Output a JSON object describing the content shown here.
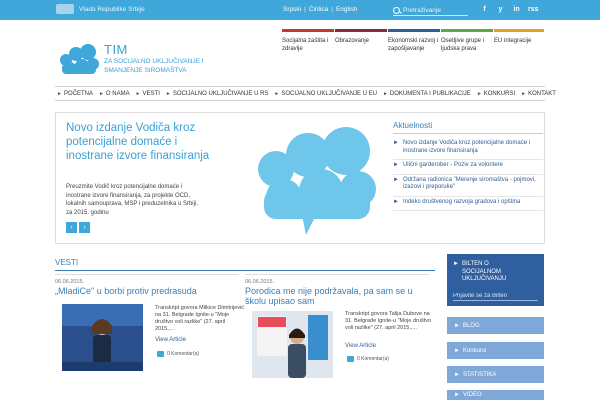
{
  "topbar": {
    "gov_label": "Vlada Republike Srbije",
    "langs": [
      "Srpski",
      "Ćirilica",
      "English"
    ],
    "search_placeholder": "Pretraživanje",
    "social": [
      "f",
      "y",
      "in",
      "rss"
    ]
  },
  "header": {
    "logo_title": "TIM",
    "logo_subtitle_1": "ZA SOCIJALNO UKLJUČIVANJE I",
    "logo_subtitle_2": "SMANJENJE SIROMAŠTVA",
    "themes": [
      {
        "label": "Socijalna zaštita i zdravlje",
        "color": "#c0392b"
      },
      {
        "label": "Obrazovanje",
        "color": "#8e2a35"
      },
      {
        "label": "Ekonomski razvoj i zapošljavanje",
        "color": "#2f5e94"
      },
      {
        "label": "Osetljive grupe i ljudska prava",
        "color": "#5aa84a"
      },
      {
        "label": "EU integracije",
        "color": "#e0a020"
      }
    ]
  },
  "nav": [
    "POČETNA",
    "O NAMA",
    "VESTI",
    "SOCIJALNO UKLJUČIVANJE U RS",
    "SOCIJALNO UKLJUČIVANJE U EU",
    "DOKUMENTA I PUBLIKACIJE",
    "KONKURSI",
    "KONTAKT"
  ],
  "hero": {
    "title": "Novo izdanje Vodiča kroz potencijalne domaće i inostrane izvore finansiranja",
    "desc": "Preuzmite Vodič kroz potencijalne domaće i inostrane izvore finansiranja, za projekte OCD, lokalnih samouprava, MSP i preduzetnika u Srbiji, za 2015. godinu",
    "prev": "‹",
    "next": "›"
  },
  "aktuelnosti": {
    "heading": "Aktuelnosti",
    "items": [
      "Novo izdanje Vodiča kroz potencijalne domaće i inostrane izvore finansiranja",
      "Ulični garderober - Poziv za volontere",
      "Održana radionica \"Merenje siromaštva - pojmovi, izazovi i preporuke\"",
      "Indeks društvenog razvoja gradova i opština"
    ]
  },
  "vesti": {
    "heading": "VESTI",
    "cards": [
      {
        "date": "06.06.2015.",
        "title": "„MladiCe\" u borbi protiv predrasuda",
        "text": "Transkript govora Milkice Dimitrijević na 31. Belgrade Ignite-u \"Moje društvo voli razlike\" (27. april 2015.,...",
        "more": "View Article",
        "comments": "0 Komentar(a)"
      },
      {
        "date": "06.06.2015.",
        "title": "Porodica me nije podržavala, pa sam se u školu upisao sam",
        "text": "Transkript govora Talija Dubove na 31. Belgrade Ignite-u \"Moje društvo voli razlike\" (27. april 2015.,...",
        "more": "View Article",
        "comments": "0 Komentar(a)"
      }
    ]
  },
  "sidebar": {
    "bilten_label_1": "BILTEN O",
    "bilten_label_2": "SOCIJALNOM",
    "bilten_label_3": "UKLJUČIVANJU",
    "bilten_placeholder": "Prijavite se za Bilten",
    "buttons": [
      "BLOG",
      "Konkursi",
      "STATISTIKA",
      "VIDEO"
    ]
  },
  "colors": {
    "accent": "#3fa7d9",
    "dark_blue": "#2f5f9e",
    "side_blue": "#7fa8d8"
  }
}
